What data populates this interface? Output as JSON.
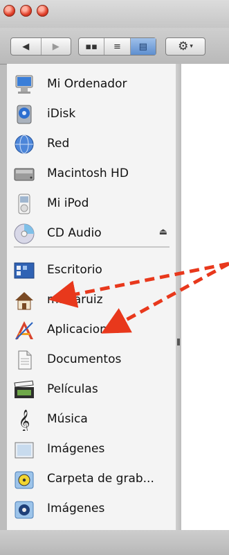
{
  "window": {
    "traffic_lights": [
      "close",
      "minimize",
      "zoom"
    ],
    "light_color": "#e0402a"
  },
  "toolbar": {
    "back_icon": "back-arrow-icon",
    "forward_icon": "forward-arrow-icon",
    "view_modes": [
      "icon-view-icon",
      "list-view-icon",
      "column-view-icon"
    ],
    "selected_view": "column-view-icon",
    "action_icon": "gear-icon",
    "action_dropdown_icon": "chevron-down-icon"
  },
  "sidebar": {
    "devices": [
      {
        "label": "Mi Ordenador",
        "icon": "computer-icon"
      },
      {
        "label": "iDisk",
        "icon": "idisk-icon"
      },
      {
        "label": "Red",
        "icon": "network-globe-icon"
      },
      {
        "label": "Macintosh HD",
        "icon": "hard-drive-icon"
      },
      {
        "label": "Mi iPod",
        "icon": "ipod-icon"
      },
      {
        "label": "CD Audio",
        "icon": "cd-icon",
        "eject": "⏏"
      }
    ],
    "places": [
      {
        "label": "Escritorio",
        "icon": "desktop-icon"
      },
      {
        "label": "mariaruiz",
        "icon": "home-icon"
      },
      {
        "label": "Aplicaciones",
        "icon": "applications-icon"
      },
      {
        "label": "Documentos",
        "icon": "documents-icon"
      },
      {
        "label": "Películas",
        "icon": "movies-icon"
      },
      {
        "label": "Música",
        "icon": "music-icon"
      },
      {
        "label": "Imágenes",
        "icon": "pictures-icon"
      },
      {
        "label": "Carpeta de grab...",
        "icon": "burn-folder-icon"
      },
      {
        "label": "Imágenes",
        "icon": "pictures-app-icon"
      }
    ]
  },
  "annotation": {
    "arrows_color": "#e8381c",
    "arrow_targets": [
      "mariaruiz",
      "Aplicaciones"
    ]
  }
}
